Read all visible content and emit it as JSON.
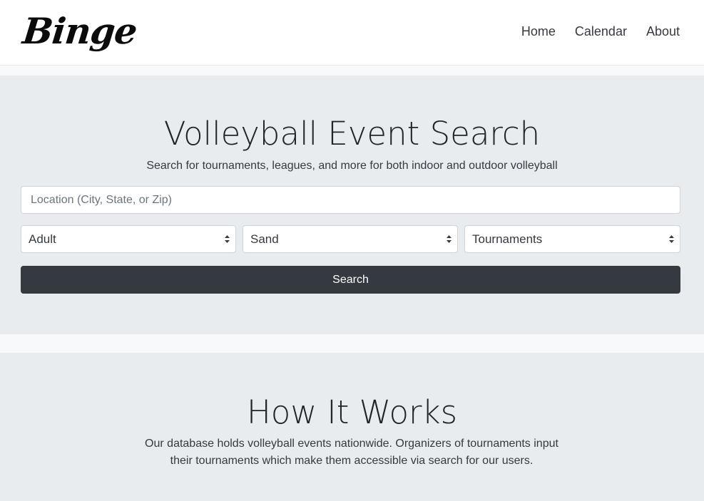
{
  "nav": {
    "brand": "Binge",
    "links": [
      "Home",
      "Calendar",
      "About"
    ]
  },
  "hero": {
    "title": "Volleyball Event Search",
    "subtitle": "Search for tournaments, leagues, and more for both indoor and outdoor volleyball",
    "location_placeholder": "Location (City, State, or Zip)",
    "selects": [
      "Adult",
      "Sand",
      "Tournaments"
    ],
    "search_label": "Search"
  },
  "how": {
    "title": "How It Works",
    "body": "Our database holds volleyball events nationwide. Organizers of tournaments input their tournaments which make them accessible via search for our users."
  },
  "icons": {
    "select_caret": "chevron-up-down-icon"
  },
  "colors": {
    "button_bg": "#343a40",
    "section_bg": "#e9ecef",
    "page_bg": "#f8f9fa"
  }
}
